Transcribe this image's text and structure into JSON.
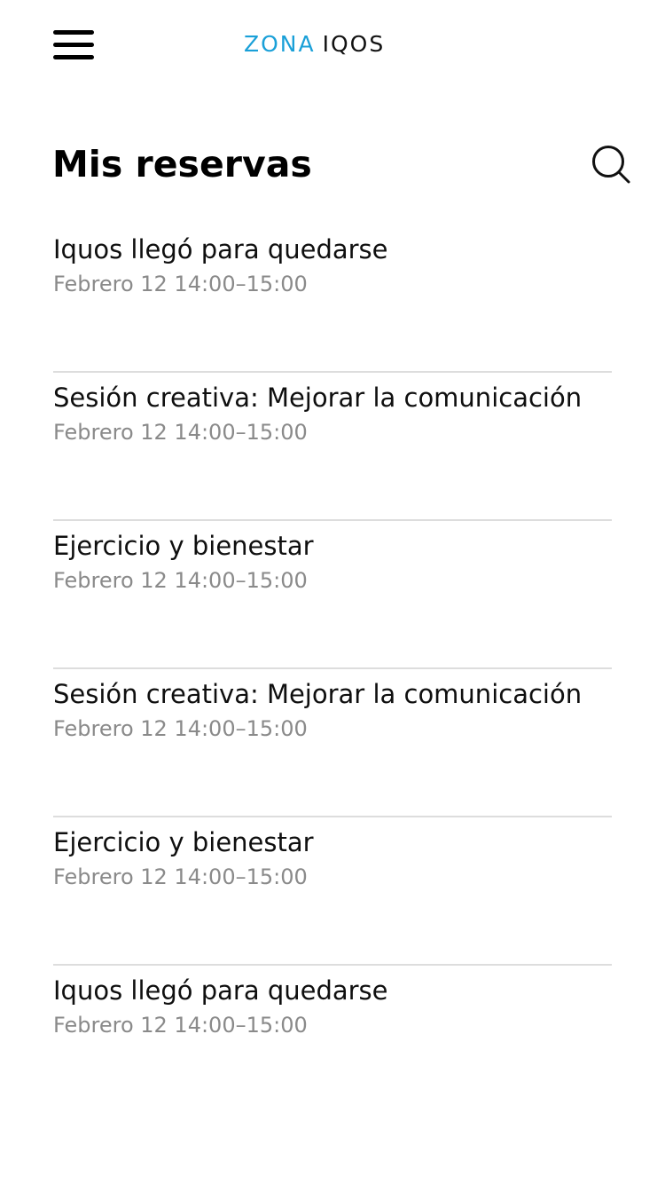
{
  "header": {
    "menu_icon": "hamburger-menu-icon",
    "logo": {
      "part1": "ZONA",
      "part2": "IQOS",
      "part1_color": "#1aa0d8",
      "part2_color": "#111111"
    },
    "search_icon": "search-icon"
  },
  "page": {
    "title": "Mis reservas"
  },
  "reservations": [
    {
      "title": "Iquos llegó para quedarse",
      "time": "Febrero 12 14:00–15:00"
    },
    {
      "title": "Sesión creativa: Mejorar la comunicación",
      "time": "Febrero 12 14:00–15:00"
    },
    {
      "title": "Ejercicio y bienestar",
      "time": "Febrero 12 14:00–15:00"
    },
    {
      "title": "Sesión creativa: Mejorar la comunicación",
      "time": "Febrero 12 14:00–15:00"
    },
    {
      "title": "Ejercicio y bienestar",
      "time": "Febrero 12 14:00–15:00"
    },
    {
      "title": "Iquos llegó para quedarse",
      "time": "Febrero 12 14:00–15:00"
    }
  ],
  "colors": {
    "title_text": "#0f0f0f",
    "time_text": "#8a8a8a",
    "divider": "#dddddd"
  }
}
